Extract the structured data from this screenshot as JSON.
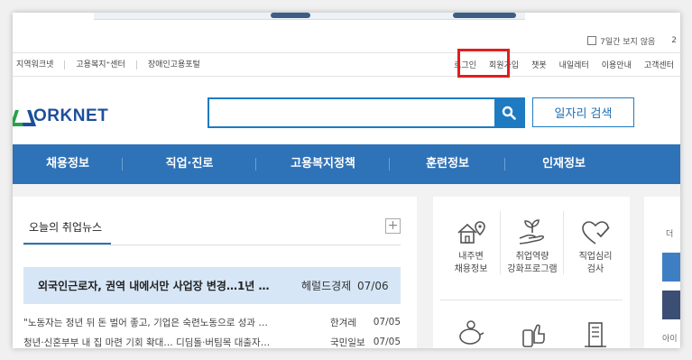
{
  "popup": {
    "label": "7일간 보지 않음",
    "extra": "2"
  },
  "util_left": [
    "지역워크넷",
    "고용복지⁺센터",
    "장애인고용포털"
  ],
  "util_right": [
    "로그인",
    "회원가입",
    "챗봇",
    "내일레터",
    "이용안내",
    "고객센터"
  ],
  "logo_text": "ORKNET",
  "search": {
    "placeholder": "",
    "button": "일자리 검색"
  },
  "gnb": [
    "채용정보",
    "직업·진로",
    "고용복지정책",
    "훈련정보",
    "인재정보"
  ],
  "news": {
    "title": "오늘의 취업뉴스",
    "headline": {
      "title": "외국인근로자, 권역 내에서만 사업장 변경…1년 …",
      "source": "헤럴드경제",
      "date": "07/06"
    },
    "items": [
      {
        "title": "\"노동자는 정년 뒤 돈 벌어 좋고, 기업은 숙련노동으로 성과 …",
        "source": "한겨레",
        "date": "07/05"
      },
      {
        "title": "청년·신혼부부 내 집 마련 기회 확대… 디딤돌·버팀목 대출자…",
        "source": "국민일보",
        "date": "07/05"
      },
      {
        "title": "",
        "source": "",
        "date": ""
      }
    ]
  },
  "services": [
    {
      "label1": "내주변",
      "label2": "채용정보",
      "icon": "house-pin-icon"
    },
    {
      "label1": "취업역량",
      "label2": "강화프로그램",
      "icon": "sprout-hand-icon"
    },
    {
      "label1": "직업심리",
      "label2": "검사",
      "icon": "heart-check-icon"
    },
    {
      "label1": "",
      "label2": "",
      "icon": "piggy-bank-icon"
    },
    {
      "label1": "",
      "label2": "",
      "icon": "thumbs-up-phone-icon"
    },
    {
      "label1": "",
      "label2": "",
      "icon": "building-icon"
    }
  ],
  "side": {
    "label_top": "더",
    "label_bottom": "아이"
  },
  "colors": {
    "brand_blue": "#2e72b8",
    "search_blue": "#1e7bc2",
    "highlight": "#e01e1e",
    "logo_green": "#27a14a",
    "headline_bg": "#d6e6f6"
  }
}
